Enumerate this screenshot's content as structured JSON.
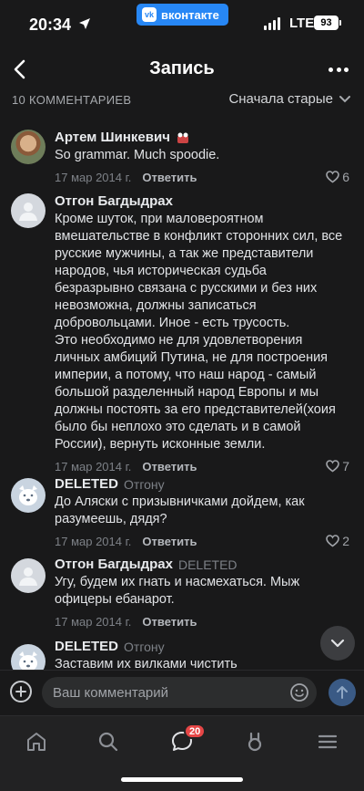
{
  "status_bar": {
    "time": "20:34",
    "app_badge": "вконтакте",
    "app_logo": "vk",
    "network": "LTE",
    "battery": "93"
  },
  "header": {
    "title": "Запись"
  },
  "comments_header": {
    "count_label": "10 КОММЕНТАРИЕВ",
    "sort_label": "Сначала старые"
  },
  "comments": [
    {
      "author": "Артем Шинкевич",
      "reply_to": "",
      "text": "So grammar. Much spoodie.",
      "date": "17 мар 2014 г.",
      "reply_label": "Ответить",
      "likes": "6"
    },
    {
      "author": "Отгон Багдыдрах",
      "reply_to": "",
      "text": "Кроме шуток, при маловероятном вмешательстве в конфликт сторонних сил, все русские мужчины, а так же представители народов, чья историческая судьба безразрывно связана с русскими и без них невозможна, должны записаться добровольцами. Иное - есть трусость.\nЭто необходимо не для удовлетворения личных амбиций Путина, не для построения империи, а потому, что наш народ - самый большой разделенный народ Европы и мы должны постоять за его представителей(хоия было бы неплохо это сделать и в самой России), вернуть исконные земли.",
      "date": "17 мар 2014 г.",
      "reply_label": "Ответить",
      "likes": "7"
    },
    {
      "author": "DELETED",
      "reply_to": "Отгону",
      "text": "До Аляски с призывничками дойдем, как разумеешь, дядя?",
      "date": "17 мар 2014 г.",
      "reply_label": "Ответить",
      "likes": "2"
    },
    {
      "author": "Отгон Багдыдрах",
      "reply_to": "DELETED",
      "text": "Угу, будем их гнать и насмехаться. Мыж офицеры ебанарот.",
      "date": "17 мар 2014 г.",
      "reply_label": "Ответить",
      "likes": ""
    },
    {
      "author": "DELETED",
      "reply_to": "Отгону",
      "text": "Заставим их вилками чистить",
      "date": "",
      "reply_label": "",
      "likes": ""
    }
  ],
  "compose": {
    "placeholder": "Ваш комментарий"
  },
  "tab_bar": {
    "messages_badge": "20"
  },
  "colors": {
    "background": "#19191a",
    "accent": "#2787f5",
    "badge": "#e64646"
  }
}
